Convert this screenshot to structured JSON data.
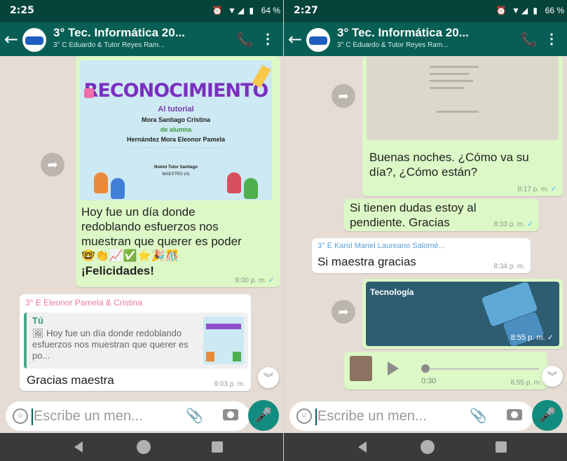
{
  "left": {
    "status": {
      "time": "2:25",
      "battery": "64 %"
    },
    "header": {
      "title": "3° Tec. Informática 20...",
      "subtitle": "3° C Eduardo & Tutor Reyes Ram..."
    },
    "image_message": {
      "poster_title": "RECONOCIMIENTO",
      "poster_lines": [
        "Al tutorial",
        "Mora Santiago Cristina",
        "de alumna",
        "Hernández Mora Eleonor Pamela",
        "Noémí Tutor Santiago",
        "MAESTRO (A)"
      ],
      "caption_lines": [
        "Hoy fue un día donde",
        "redoblando esfuerzos nos",
        "muestran que querer es poder"
      ],
      "emoji_row": "🤓👏📈✅⭐🎉🎊",
      "caption_bold": "¡Felicidades!",
      "time": "9:00 p. m."
    },
    "reply_message": {
      "sender": "3° E Eleonor Pamela & Cristina",
      "quote_author": "Tú",
      "quote_text": "🖼 Hoy fue un día donde redoblando esfuerzos nos muestran que querer es po...",
      "text": "Gracias maestra",
      "time": "9:03 p. m."
    },
    "input": {
      "placeholder": "Escribe un men..."
    }
  },
  "right": {
    "status": {
      "time": "2:27",
      "battery": "66 %"
    },
    "header": {
      "title": "3° Tec. Informática 20...",
      "subtitle": "3° C Eduardo & Tutor Reyes Ram..."
    },
    "messages": [
      {
        "text": "Buenas noches. ¿Cómo va su día?, ¿Cómo están?",
        "time": "8:17 p. m."
      },
      {
        "text": "Si tienen dudas estoy al pendiente. Gracias",
        "time": "8:33 p. m."
      }
    ],
    "incoming": {
      "sender": "3° E Karol Mariel Laureano Salomé...",
      "text": "Si maestra gracias",
      "time": "8:34 p. m."
    },
    "image_message": {
      "label": "Tecnología",
      "time": "8:55 p. m."
    },
    "audio_message": {
      "duration": "0:30",
      "time": "8:55 p. m."
    },
    "input": {
      "placeholder": "Escribe un men..."
    }
  },
  "colors": {
    "header": "#075e54",
    "status_bar": "#05443b",
    "outgoing_bubble": "#dcf8c6",
    "chat_background": "#e5ddd5",
    "mic_button": "#128c7e",
    "read_ticks": "#4fc3f7"
  },
  "icons": [
    "back-arrow-icon",
    "group-avatar",
    "add-call-icon",
    "more-options-icon",
    "forward-icon",
    "emoji-icon",
    "attach-icon",
    "camera-icon",
    "mic-icon",
    "play-icon",
    "scroll-down-icon",
    "nav-back-icon",
    "nav-home-icon",
    "nav-recents-icon"
  ]
}
